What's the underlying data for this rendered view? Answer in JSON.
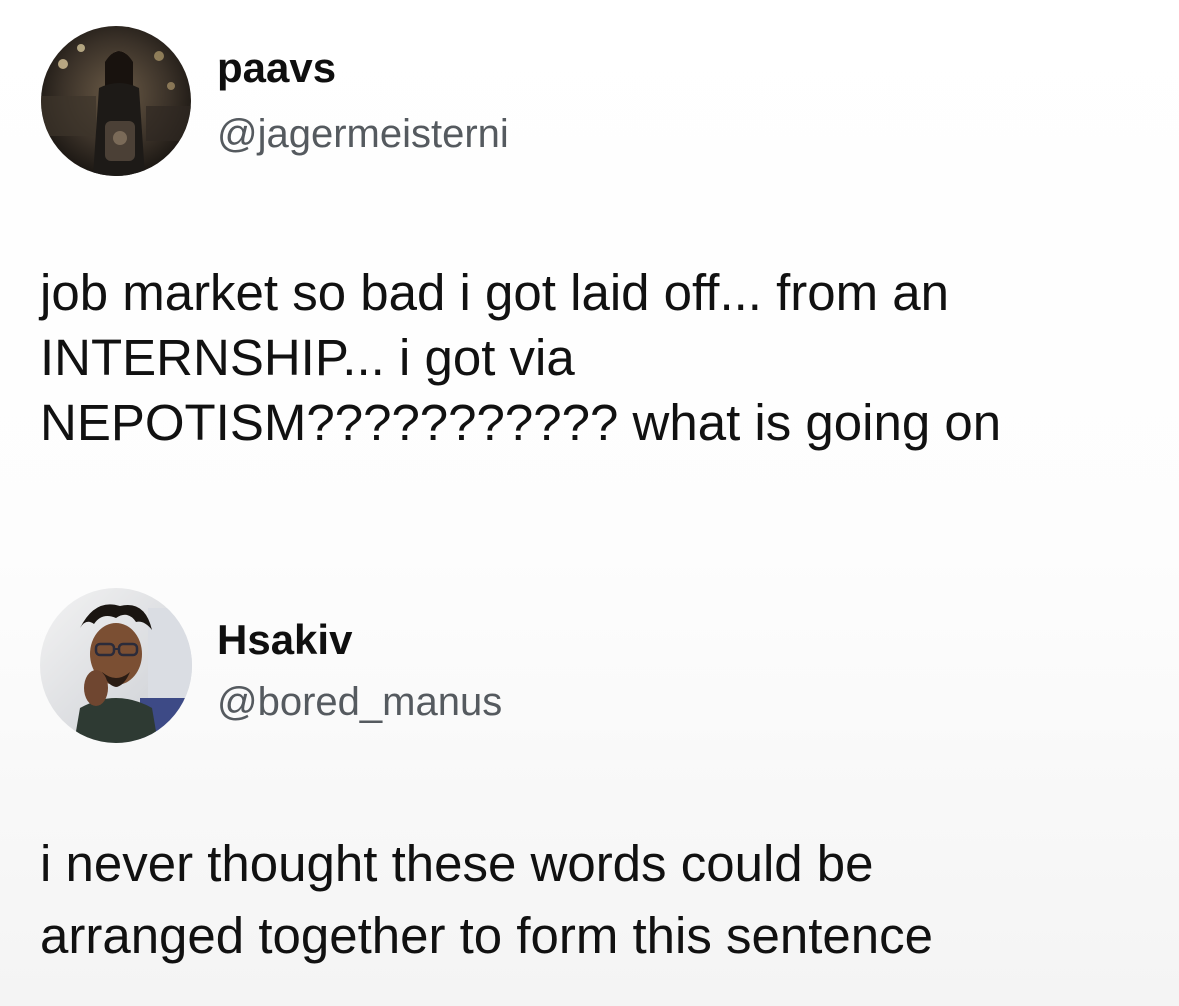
{
  "posts": [
    {
      "author": {
        "display_name": "paavs",
        "handle": "@jagermeisterni",
        "avatar_icon": "profile-photo"
      },
      "text_lines": [
        "job market so bad i got laid off... from an",
        "INTERNSHIP... i got via",
        "NEPOTISM??????????? what is going on"
      ]
    },
    {
      "author": {
        "display_name": "Hsakiv",
        "handle": "@bored_manus",
        "avatar_icon": "profile-photo"
      },
      "text_lines": [
        "i never thought these words could be",
        "arranged together to form this sentence"
      ]
    }
  ],
  "colors": {
    "text": "#111111",
    "handle": "#555a5f",
    "background": "#ffffff"
  }
}
